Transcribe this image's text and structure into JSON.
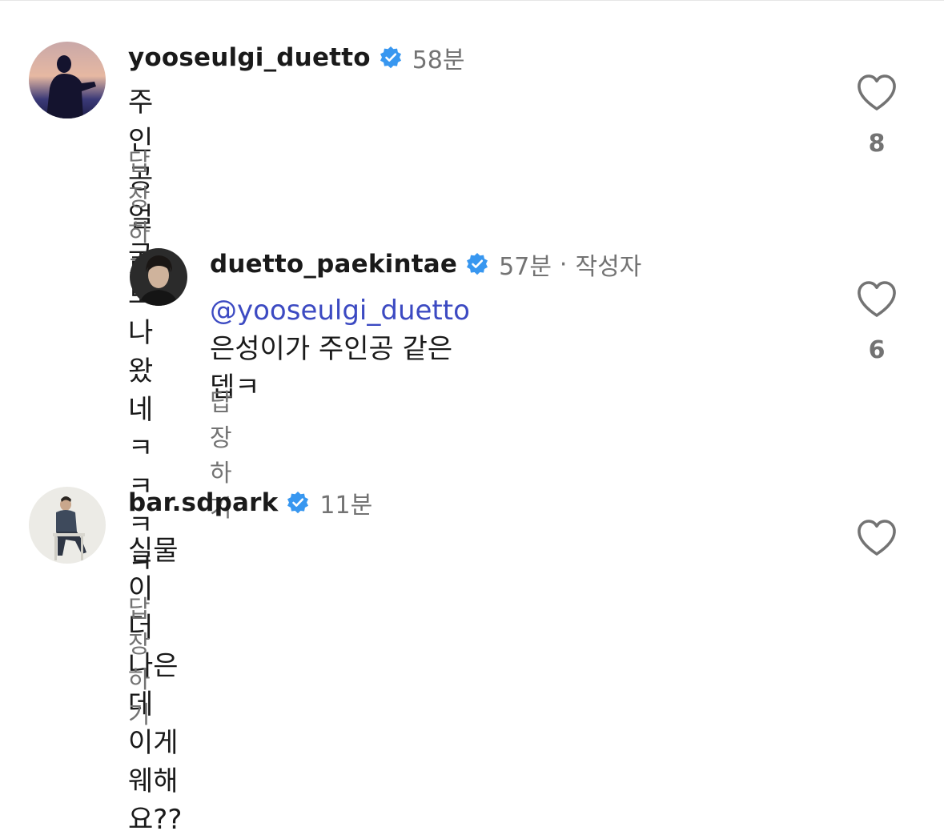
{
  "comments": [
    {
      "username": "yooseulgi_duetto",
      "verified": true,
      "time": "58분",
      "text": "주인공 얼굴로 나왔네 ㅋㅋㅋㅋ",
      "reply_label": "답장하기",
      "like_count": "8",
      "avatar_icon": "silhouette-portrait"
    },
    {
      "username": "duetto_paekintae",
      "verified": true,
      "time": "57분",
      "separator": "·",
      "author_badge": "작성자",
      "mention": "@yooseulgi_duetto",
      "text_line1": "은성이가 주인공 같은",
      "text_line2": "뎁ㅋ",
      "reply_label": "답장하기",
      "like_count": "6",
      "avatar_icon": "portrait-photo"
    },
    {
      "username": "bar.sdpark",
      "verified": true,
      "time": "11분",
      "text": "실물이 더 나은데 이게 웨해요??",
      "reply_label": "답장하기",
      "avatar_icon": "seated-man-photo"
    }
  ],
  "colors": {
    "verified_blue": "#3897f0",
    "mention": "#3c4ac2",
    "meta_gray": "#737373"
  }
}
